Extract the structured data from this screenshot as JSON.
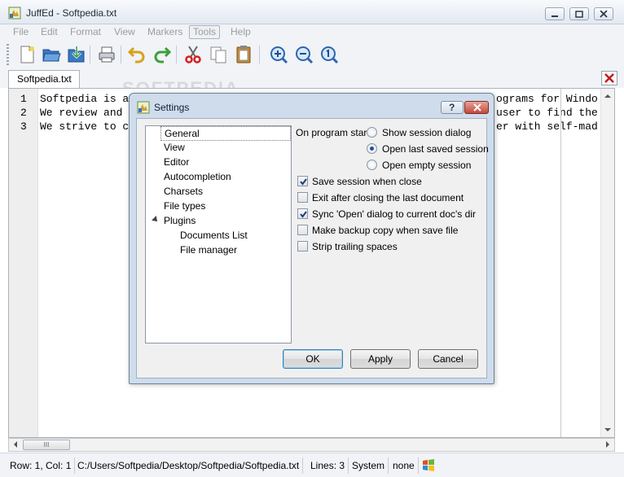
{
  "window": {
    "title": "JuffEd - Softpedia.txt",
    "icon": "app-icon"
  },
  "menu": {
    "items": [
      "File",
      "Edit",
      "Format",
      "View",
      "Markers",
      "Tools",
      "Help"
    ],
    "active": "Tools"
  },
  "toolbar": {
    "buttons": [
      "new-file-icon",
      "open-file-icon",
      "save-file-icon",
      "print-icon",
      "undo-icon",
      "redo-icon",
      "cut-icon",
      "copy-icon",
      "paste-icon",
      "zoom-in-icon",
      "zoom-out-icon",
      "zoom-reset-icon"
    ]
  },
  "tabs": {
    "active_tab": "Softpedia.txt"
  },
  "editor": {
    "lines": [
      {
        "number": "1",
        "text": "Softpedia is a"
      },
      {
        "number": "2",
        "text": "We review and"
      },
      {
        "number": "3",
        "text": "We strive to c"
      }
    ],
    "line_tails": [
      "ograms for Windo",
      "user to find the",
      "er with self-mad"
    ]
  },
  "hscroll": {
    "thumb_glyph": "III"
  },
  "status": {
    "position": "Row: 1, Col: 1",
    "path": "C:/Users/Softpedia/Desktop/Softpedia/Softpedia.txt",
    "lines": "Lines: 3",
    "charset": "System",
    "eol": "none"
  },
  "dialog": {
    "title": "Settings",
    "tree": {
      "items": [
        "General",
        "View",
        "Editor",
        "Autocompletion",
        "Charsets",
        "File types",
        "Plugins"
      ],
      "plugin_children": [
        "Documents List",
        "File manager"
      ],
      "selected": "General"
    },
    "on_start_label": "On program start",
    "radios": [
      {
        "label": "Show session dialog",
        "checked": false
      },
      {
        "label": "Open last saved session",
        "checked": true
      },
      {
        "label": "Open empty session",
        "checked": false
      }
    ],
    "checkboxes": [
      {
        "label": "Save session when close",
        "checked": true
      },
      {
        "label": "Exit after closing the last document",
        "checked": false
      },
      {
        "label": "Sync 'Open' dialog to current doc's dir",
        "checked": true
      },
      {
        "label": "Make backup copy when save file",
        "checked": false
      },
      {
        "label": "Strip trailing spaces",
        "checked": false
      }
    ],
    "buttons": {
      "ok": "OK",
      "apply": "Apply",
      "cancel": "Cancel"
    },
    "help_glyph": "?"
  },
  "watermark": "SOFTPEDIA"
}
